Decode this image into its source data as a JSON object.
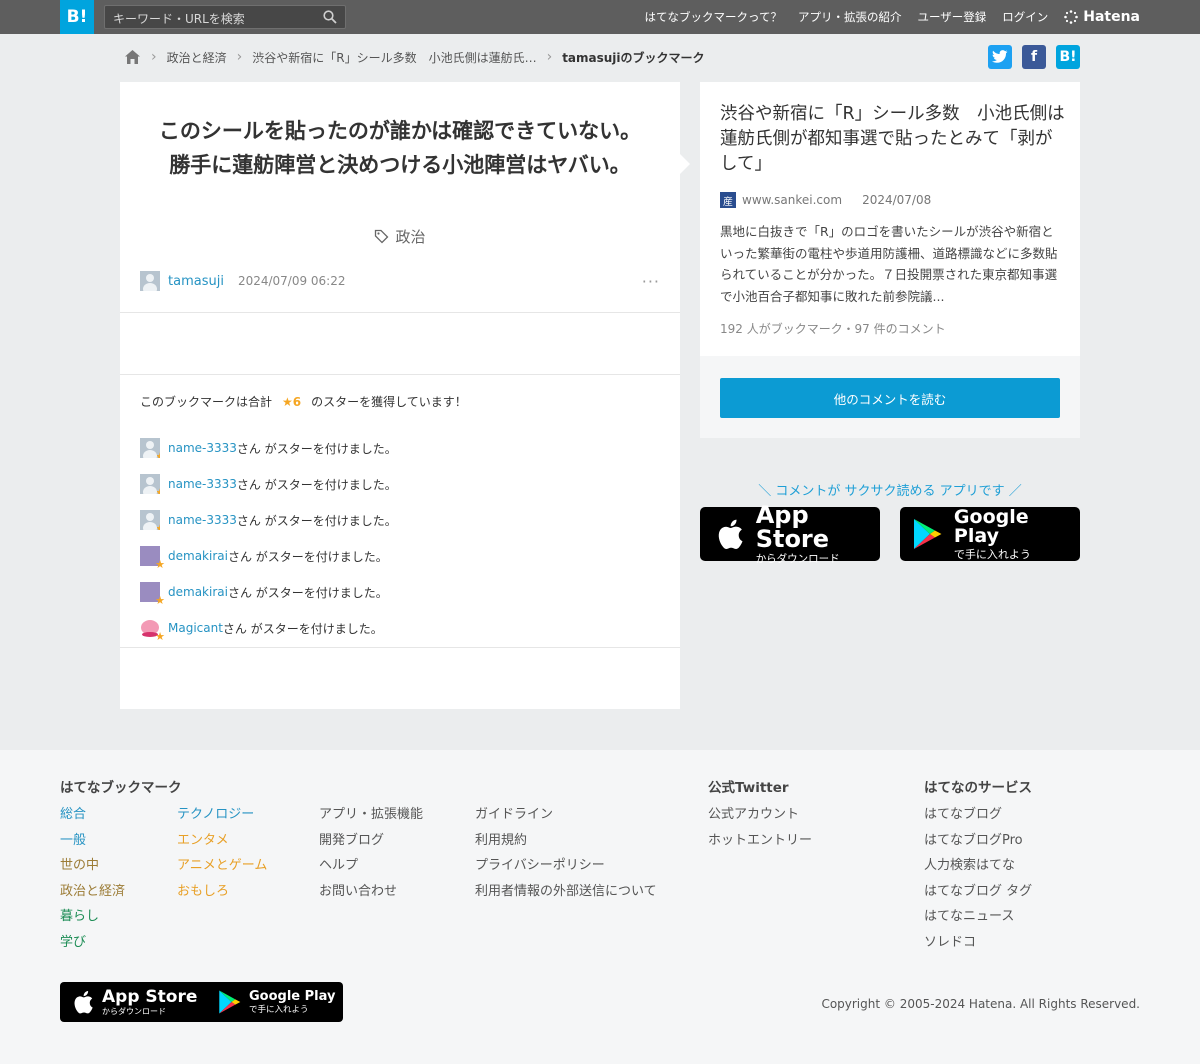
{
  "header": {
    "logo": "B!",
    "search_placeholder": "キーワード・URLを検索",
    "nav": [
      "はてなブックマークって？",
      "アプリ・拡張の紹介",
      "ユーザー登録",
      "ログイン"
    ],
    "hatena": "Hatena"
  },
  "breadcrumb": {
    "items": [
      "政治と経済",
      "渋谷や新宿に「R」シール多数　小池氏側は蓮舫氏…"
    ],
    "current": "tamasujiのブックマーク"
  },
  "share": {
    "twitter": "t",
    "facebook": "f",
    "hatena": "B!"
  },
  "bookmark": {
    "comment": "このシールを貼ったのが誰かは確認できていない。勝手に蓮舫陣営と決めつける小池陣営はヤバい。",
    "tag": "政治",
    "user": "tamasuji",
    "date": "2024/07/09 06:22",
    "more": "···",
    "star_summary_prefix": "このブックマークは合計",
    "star_count": "★6",
    "star_summary_suffix": "のスターを獲得しています！",
    "stars": [
      {
        "user": "name-3333",
        "text": "さん がスターを付けました。",
        "avatar": "grey"
      },
      {
        "user": "name-3333",
        "text": "さん がスターを付けました。",
        "avatar": "grey"
      },
      {
        "user": "name-3333",
        "text": "さん がスターを付けました。",
        "avatar": "grey"
      },
      {
        "user": "demakirai",
        "text": "さん がスターを付けました。",
        "avatar": "purple"
      },
      {
        "user": "demakirai",
        "text": "さん がスターを付けました。",
        "avatar": "purple"
      },
      {
        "user": "Magicant",
        "text": "さん がスターを付けました。",
        "avatar": "pink"
      }
    ]
  },
  "entry": {
    "title": "渋谷や新宿に「R」シール多数　小池氏側は蓮舫氏側が都知事選で貼ったとみて「剥がして」",
    "favicon": "産",
    "domain": "www.sankei.com",
    "date": "2024/07/08",
    "summary": "黒地に白抜きで「R」のロゴを書いたシールが渋谷や新宿といった繁華街の電柱や歩道用防護柵、道路標識などに多数貼られていることが分かった。７日投開票された東京都知事選で小池百合子都知事に敗れた前参院議...",
    "count": "192 人がブックマーク・97 件のコメント",
    "read_button": "他のコメントを読む"
  },
  "promo": {
    "text": "＼ コメントが サクサク読める アプリです ／",
    "app_store_big": "App Store",
    "app_store_small": "からダウンロード",
    "google_play_big": "Google Play",
    "google_play_small": "で手に入れよう"
  },
  "footer": {
    "bookmark_heading": "はてなブックマーク",
    "cat_col1": [
      "総合",
      "一般",
      "世の中",
      "政治と経済",
      "暮らし",
      "学び"
    ],
    "cat_col2": [
      "テクノロジー",
      "エンタメ",
      "アニメとゲーム",
      "おもしろ"
    ],
    "links_col1": [
      "アプリ・拡張機能",
      "開発ブログ",
      "ヘルプ",
      "お問い合わせ"
    ],
    "links_col2": [
      "ガイドライン",
      "利用規約",
      "プライバシーポリシー",
      "利用者情報の外部送信について"
    ],
    "twitter_heading": "公式Twitter",
    "twitter_links": [
      "公式アカウント",
      "ホットエントリー"
    ],
    "services_heading": "はてなのサービス",
    "services": [
      "はてなブログ",
      "はてなブログPro",
      "人力検索はてな",
      "はてなブログ タグ",
      "はてなニュース",
      "ソレドコ"
    ],
    "copyright": "Copyright © 2005-2024 Hatena. All Rights Reserved."
  },
  "colors": {
    "accent": "#00a4de",
    "link": "#2693c3",
    "button": "#0c9bd3",
    "star": "#f5a623"
  }
}
